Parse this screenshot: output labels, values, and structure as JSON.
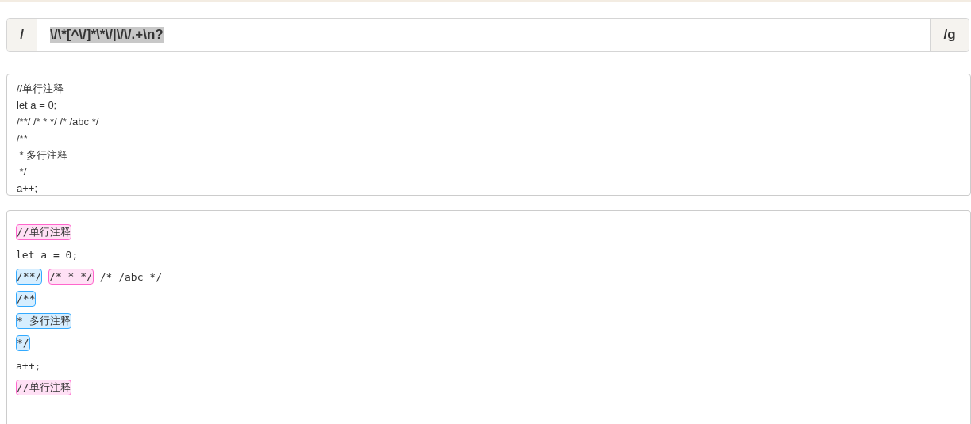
{
  "regex": {
    "open": "/",
    "pattern": "\\/\\*[^\\/]*\\*\\/|\\/\\/.+\\n?",
    "pattern_selected": true,
    "flags": "/g"
  },
  "source_lines": [
    "//单行注释",
    "let a = 0;",
    "/**/ /* * */ /* /abc */",
    "/**",
    " * 多行注释",
    " */",
    "a++;"
  ],
  "result_lines": [
    [
      {
        "kind": "match",
        "text": "//单行注释",
        "color": "#ff66cc"
      }
    ],
    [
      {
        "kind": "plain",
        "text": "let a = 0;"
      }
    ],
    [
      {
        "kind": "match",
        "text": "/**/",
        "color": "#33aaff"
      },
      {
        "kind": "match",
        "text": "/* * */",
        "color": "#ff66cc"
      },
      {
        "kind": "plain",
        "text": "/* /abc */"
      }
    ],
    [
      {
        "kind": "match",
        "text": "/**",
        "color": "#33aaff"
      }
    ],
    [
      {
        "kind": "match",
        "text": "* 多行注释",
        "color": "#33aaff"
      }
    ],
    [
      {
        "kind": "match",
        "text": "*/",
        "color": "#33aaff"
      }
    ],
    [
      {
        "kind": "plain",
        "text": "a++;"
      }
    ],
    [
      {
        "kind": "match",
        "text": "//单行注释",
        "color": "#ff66cc"
      }
    ]
  ]
}
